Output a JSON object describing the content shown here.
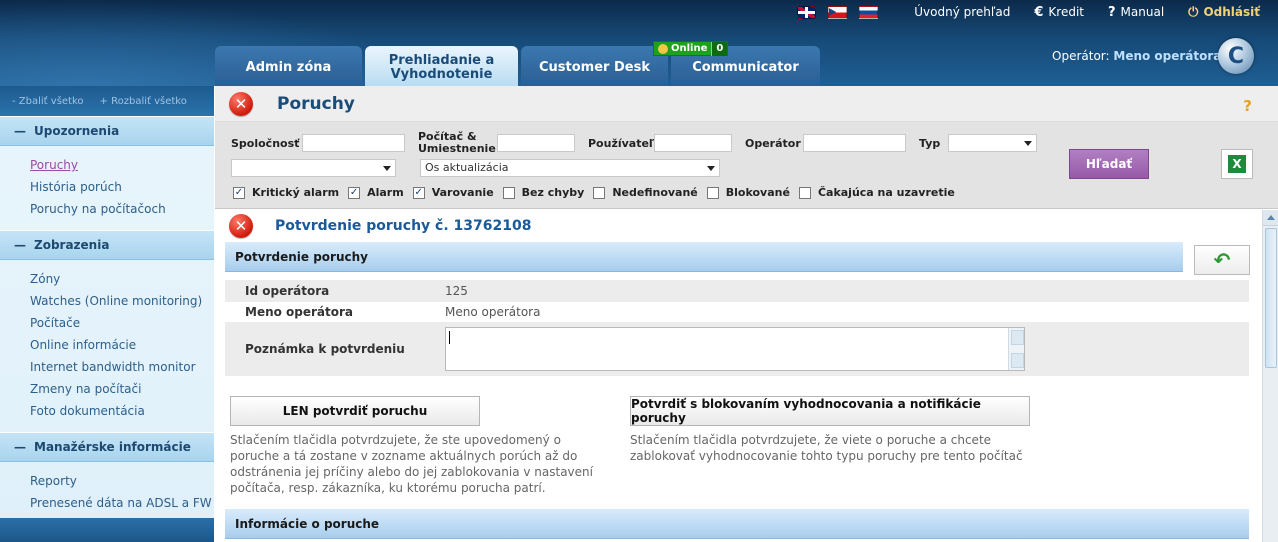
{
  "header": {
    "flags": [
      "en-flag",
      "cz-flag",
      "sk-flag"
    ],
    "links": [
      {
        "label": "Úvodný prehľad",
        "icon": ""
      },
      {
        "label": "Kredit",
        "icon": "€"
      },
      {
        "label": "Manual",
        "icon": "?"
      },
      {
        "label": "Odhlásiť",
        "icon": "⏻"
      }
    ],
    "tabs": [
      "Admin zóna",
      "Prehliadanie a Vyhodnotenie",
      "Customer Desk",
      "Communicator"
    ],
    "online_label": "Online",
    "online_count": "0",
    "operator_prefix": "Operátor:",
    "operator_name": "Meno operátora",
    "logo_letter": "C"
  },
  "sidebar": {
    "collapse_all": "Zbaliť všetko",
    "expand_all": "Rozbaliť všetko",
    "sections": [
      {
        "title": "Upozornenia",
        "items": [
          "Poruchy",
          "História porúch",
          "Poruchy na počítačoch"
        ]
      },
      {
        "title": "Zobrazenia",
        "items": [
          "Zóny",
          "Watches (Online monitoring)",
          "Počítače",
          "Online informácie",
          "Internet bandwidth monitor",
          "Zmeny na počítači",
          "Foto dokumentácia"
        ]
      },
      {
        "title": "Manažérske informácie",
        "items": [
          "Reporty",
          "Prenesené dáta na ADSL a FW"
        ]
      }
    ],
    "current_item": "Poruchy"
  },
  "page": {
    "title": "Poruchy",
    "help": "?"
  },
  "filters": {
    "company_label": "Spoločnosť",
    "computer_label": "Počítač & Umiestnenie",
    "user_label": "Používateľ",
    "operator_label": "Operátor",
    "type_label": "Typ",
    "second_select_value": "Os aktualizácia",
    "search_button": "Hľadať",
    "excel_icon": "X",
    "checkboxes": [
      {
        "label": "Kritický alarm",
        "checked": true
      },
      {
        "label": "Alarm",
        "checked": true
      },
      {
        "label": "Varovanie",
        "checked": true
      },
      {
        "label": "Bez chyby",
        "checked": false
      },
      {
        "label": "Nedefinované",
        "checked": false
      },
      {
        "label": "Blokované",
        "checked": false
      },
      {
        "label": "Čakajúca na uzavretie",
        "checked": false
      }
    ]
  },
  "confirm": {
    "title": "Potvrdenie poruchy č. 13762108",
    "section_label": "Potvrdenie poruchy",
    "fields": {
      "op_id_label": "Id operátora",
      "op_id_value": "125",
      "op_name_label": "Meno operátora",
      "op_name_value": "Meno operátora",
      "note_label": "Poznámka k potvrdeniu"
    },
    "btn_only": "LEN potvrdiť poruchu",
    "btn_only_desc": "Stlačením tlačidla potvrdzujete, že ste upovedomený o poruche a tá zostane v zozname aktuálnych porúch až do odstránenia jej príčiny alebo do jej zablokovania v nastavení počítača, resp. zákazníka, ku ktorému porucha patrí.",
    "btn_block": "Potvrdiť s blokovaním vyhodnocovania a notifikácie poruchy",
    "btn_block_desc": "Stlačením tlačidla potvrdzujete, že viete o poruche a chcete zablokovať vyhodnocovanie tohto typu poruchy pre tento počítač",
    "info_section": "Informácie o poruche"
  }
}
